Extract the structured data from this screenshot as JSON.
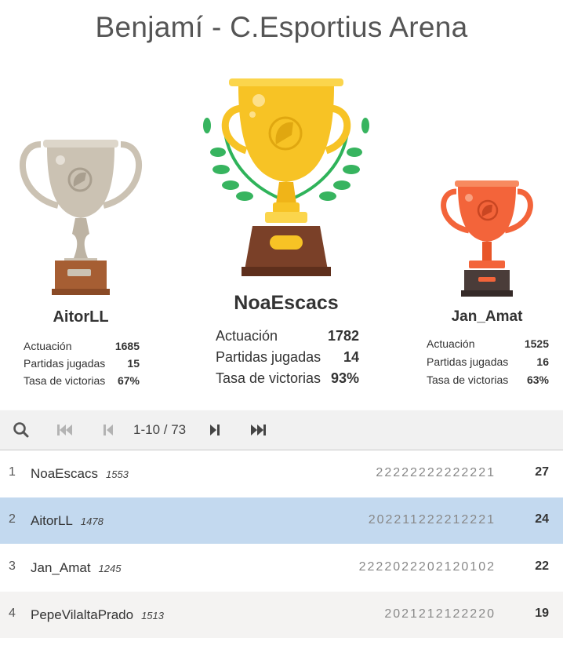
{
  "title": "Benjamí - C.Esportius Arena",
  "podium": {
    "first": {
      "name": "NoaEscacs",
      "stats": [
        {
          "label": "Actuación",
          "value": "1782"
        },
        {
          "label": "Partidas jugadas",
          "value": "14"
        },
        {
          "label": "Tasa de victorias",
          "value": "93%"
        }
      ]
    },
    "second": {
      "name": "AitorLL",
      "stats": [
        {
          "label": "Actuación",
          "value": "1685"
        },
        {
          "label": "Partidas jugadas",
          "value": "15"
        },
        {
          "label": "Tasa de victorias",
          "value": "67%"
        }
      ]
    },
    "third": {
      "name": "Jan_Amat",
      "stats": [
        {
          "label": "Actuación",
          "value": "1525"
        },
        {
          "label": "Partidas jugadas",
          "value": "16"
        },
        {
          "label": "Tasa de victorias",
          "value": "63%"
        }
      ]
    }
  },
  "toolbar": {
    "search_icon": "search-icon",
    "first_icon": "skip-first-icon",
    "prev_icon": "previous-icon",
    "page_text": "1-10 / 73",
    "next_icon": "next-icon",
    "last_icon": "skip-last-icon"
  },
  "standings": [
    {
      "rank": "1",
      "name": "NoaEscacs",
      "rating": "1553",
      "results": "22222222222221",
      "score": "27"
    },
    {
      "rank": "2",
      "name": "AitorLL",
      "rating": "1478",
      "results": "202211222212221",
      "score": "24"
    },
    {
      "rank": "3",
      "name": "Jan_Amat",
      "rating": "1245",
      "results": "2222022202120102",
      "score": "22"
    },
    {
      "rank": "4",
      "name": "PepeVilaltaPrado",
      "rating": "1513",
      "results": "2021212122220",
      "score": "19"
    }
  ],
  "colors": {
    "gold": "#f7c325",
    "silver": "#cbc2b3",
    "bronze": "#f3643a",
    "highlight_row": "#c3d9ef"
  }
}
